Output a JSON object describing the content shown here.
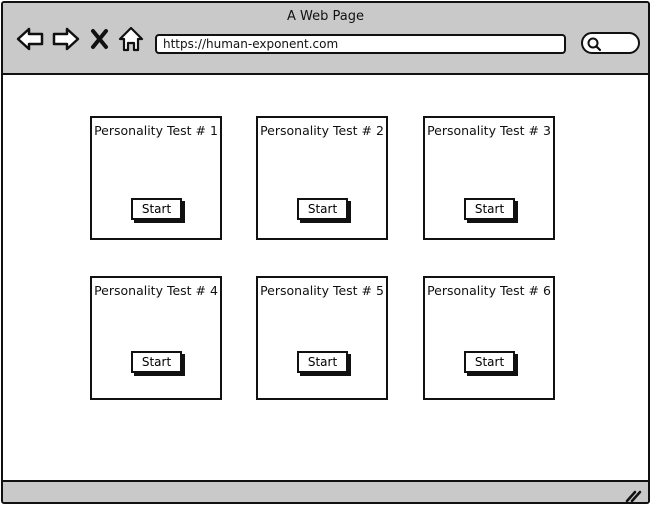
{
  "window": {
    "title": "A Web Page"
  },
  "toolbar": {
    "icons": [
      "back-arrow-icon",
      "forward-arrow-icon",
      "close-icon",
      "home-icon"
    ],
    "url": "https://human-exponent.com",
    "search_icon": "search-icon"
  },
  "tests": [
    {
      "title": "Personality Test # 1",
      "button": "Start"
    },
    {
      "title": "Personality Test # 2",
      "button": "Start"
    },
    {
      "title": "Personality Test # 3",
      "button": "Start"
    },
    {
      "title": "Personality Test # 4",
      "button": "Start"
    },
    {
      "title": "Personality Test # 5",
      "button": "Start"
    },
    {
      "title": "Personality Test # 6",
      "button": "Start"
    }
  ],
  "colors": {
    "chrome": "#c9c9c9",
    "stroke": "#111111",
    "background": "#ffffff"
  }
}
